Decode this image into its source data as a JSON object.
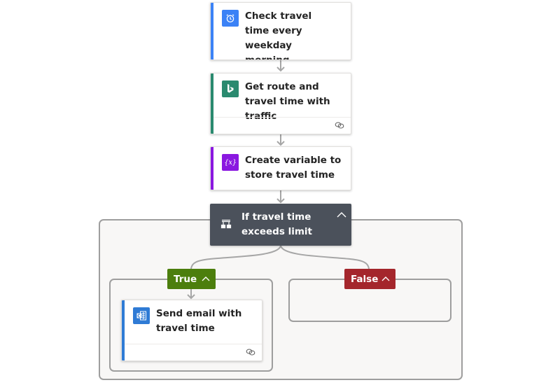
{
  "colors": {
    "trigger_accent": "#3b82f6",
    "bing_accent": "#2a8a6f",
    "variable_accent": "#8a18e0",
    "outlook_accent": "#2f7bd5",
    "condition_bg": "#4b515b",
    "true_bg": "#4c7e0d",
    "false_bg": "#a4262c",
    "connector": "#a6a6a6"
  },
  "steps": [
    {
      "title": "Check travel time every weekday morning",
      "icon": "alarm-clock-icon",
      "type": "trigger"
    },
    {
      "title": "Get route and travel time with traffic",
      "icon": "bing-maps-icon",
      "type": "action",
      "footer_icon": "link-icon"
    },
    {
      "title": "Create variable to store travel time",
      "icon": "variable-icon",
      "icon_text": "{x}",
      "type": "action"
    }
  ],
  "condition": {
    "title": "If travel time exceeds limit",
    "icon": "condition-icon",
    "collapse_icon": "chevron-up-icon"
  },
  "branches": {
    "true": {
      "label": "True",
      "collapse_icon": "chevron-up-icon",
      "actions": [
        {
          "title": "Send email with travel time",
          "icon": "outlook-icon",
          "footer_icon": "link-icon"
        }
      ]
    },
    "false": {
      "label": "False",
      "collapse_icon": "chevron-up-icon",
      "actions": []
    }
  }
}
